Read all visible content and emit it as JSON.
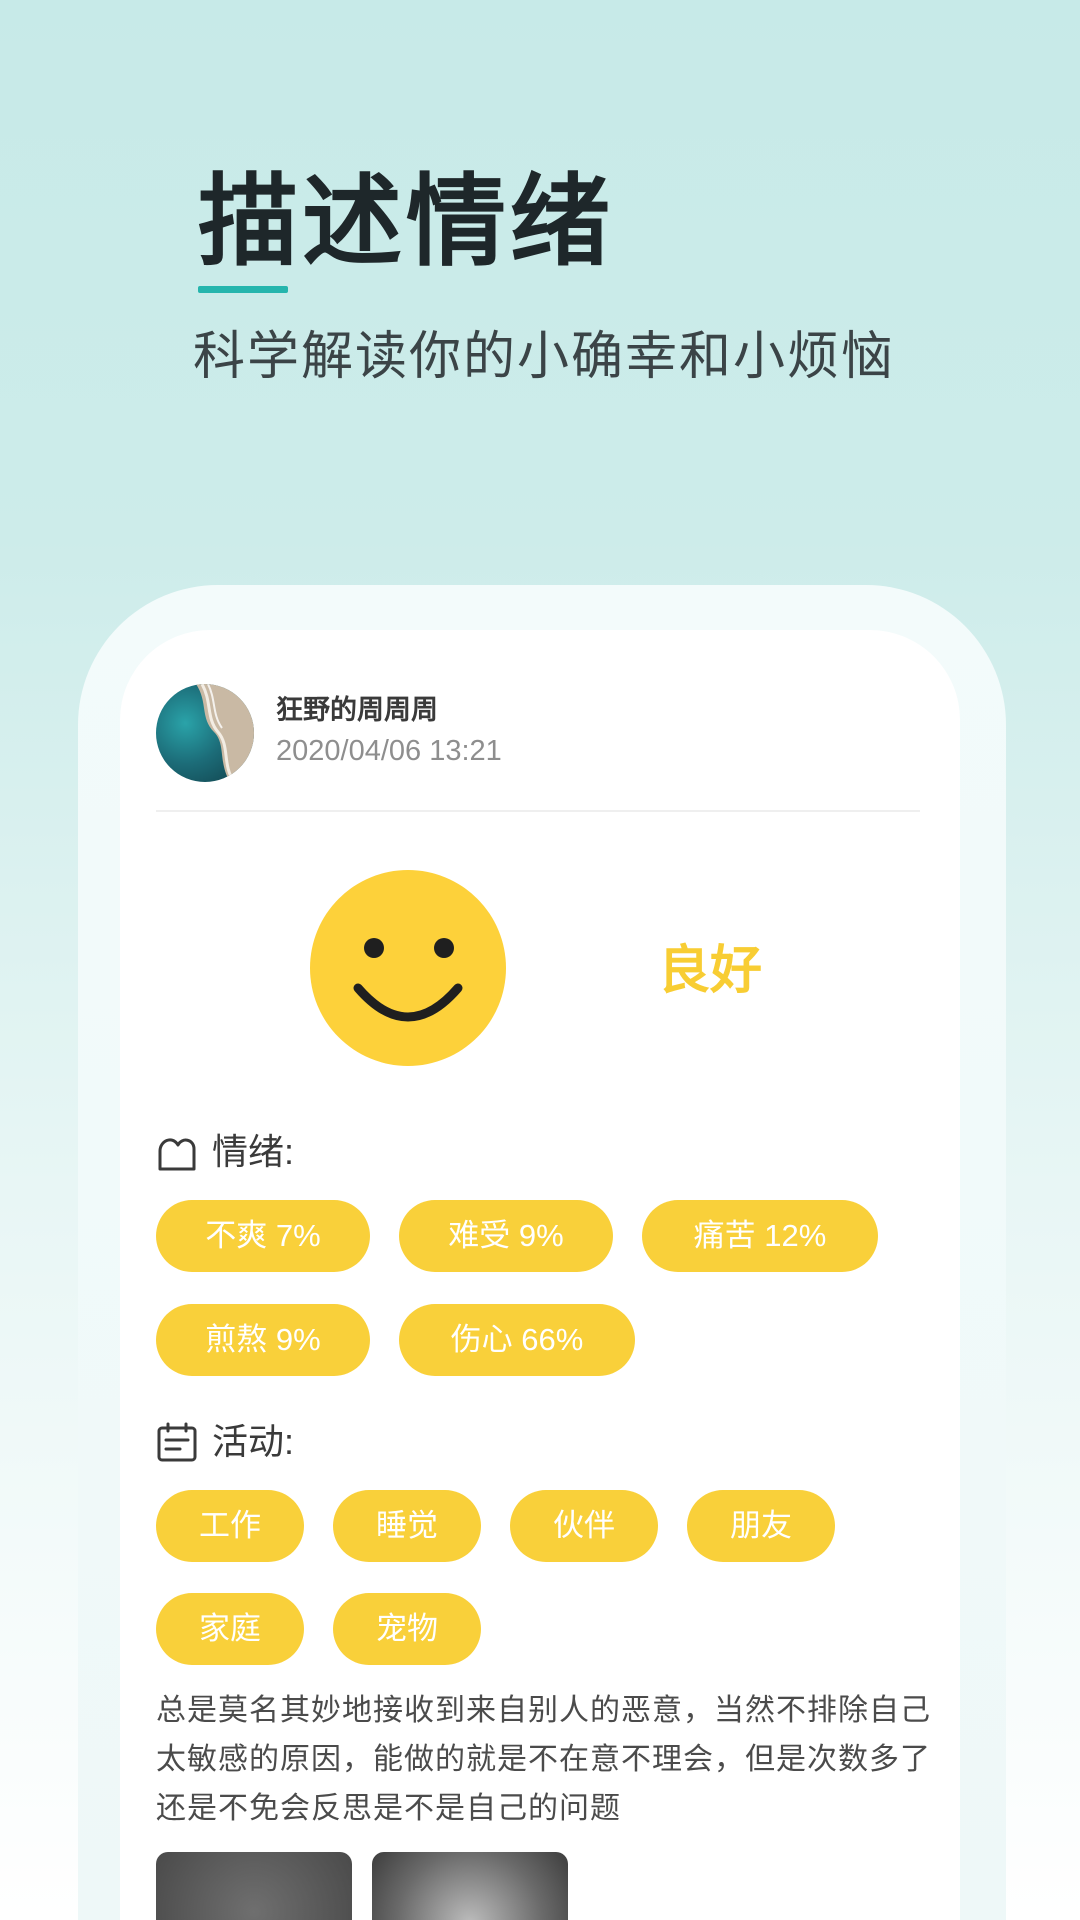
{
  "header": {
    "title": "描述情绪",
    "subtitle": "科学解读你的小确幸和小烦恼",
    "accent_color": "#25b5ad"
  },
  "post": {
    "user": {
      "name": "狂野的周周周",
      "avatar_icon": "avatar-photo"
    },
    "timestamp": "2020/04/06 13:21",
    "mood": {
      "icon": "smiley-face-icon",
      "label": "良好",
      "color": "#f8cd33"
    },
    "emotions": {
      "icon": "heart-outline-icon",
      "label": "情绪:",
      "tags": [
        "不爽 7%",
        "难受 9%",
        "痛苦 12%",
        "煎熬 9%",
        "伤心 66%"
      ]
    },
    "activities": {
      "icon": "calendar-icon",
      "label": "活动:",
      "tags": [
        "工作",
        "睡觉",
        "伙伴",
        "朋友",
        "家庭",
        "宠物"
      ]
    },
    "body": "总是莫名其妙地接收到来自别人的恶意，当然不排除自己太敏感的原因，能做的就是不在意不理会，但是次数多了还是不免会反思是不是自己的问题",
    "photos": [
      "photo-thumbnail",
      "photo-thumbnail"
    ],
    "tag_color": "#f9d03a"
  }
}
